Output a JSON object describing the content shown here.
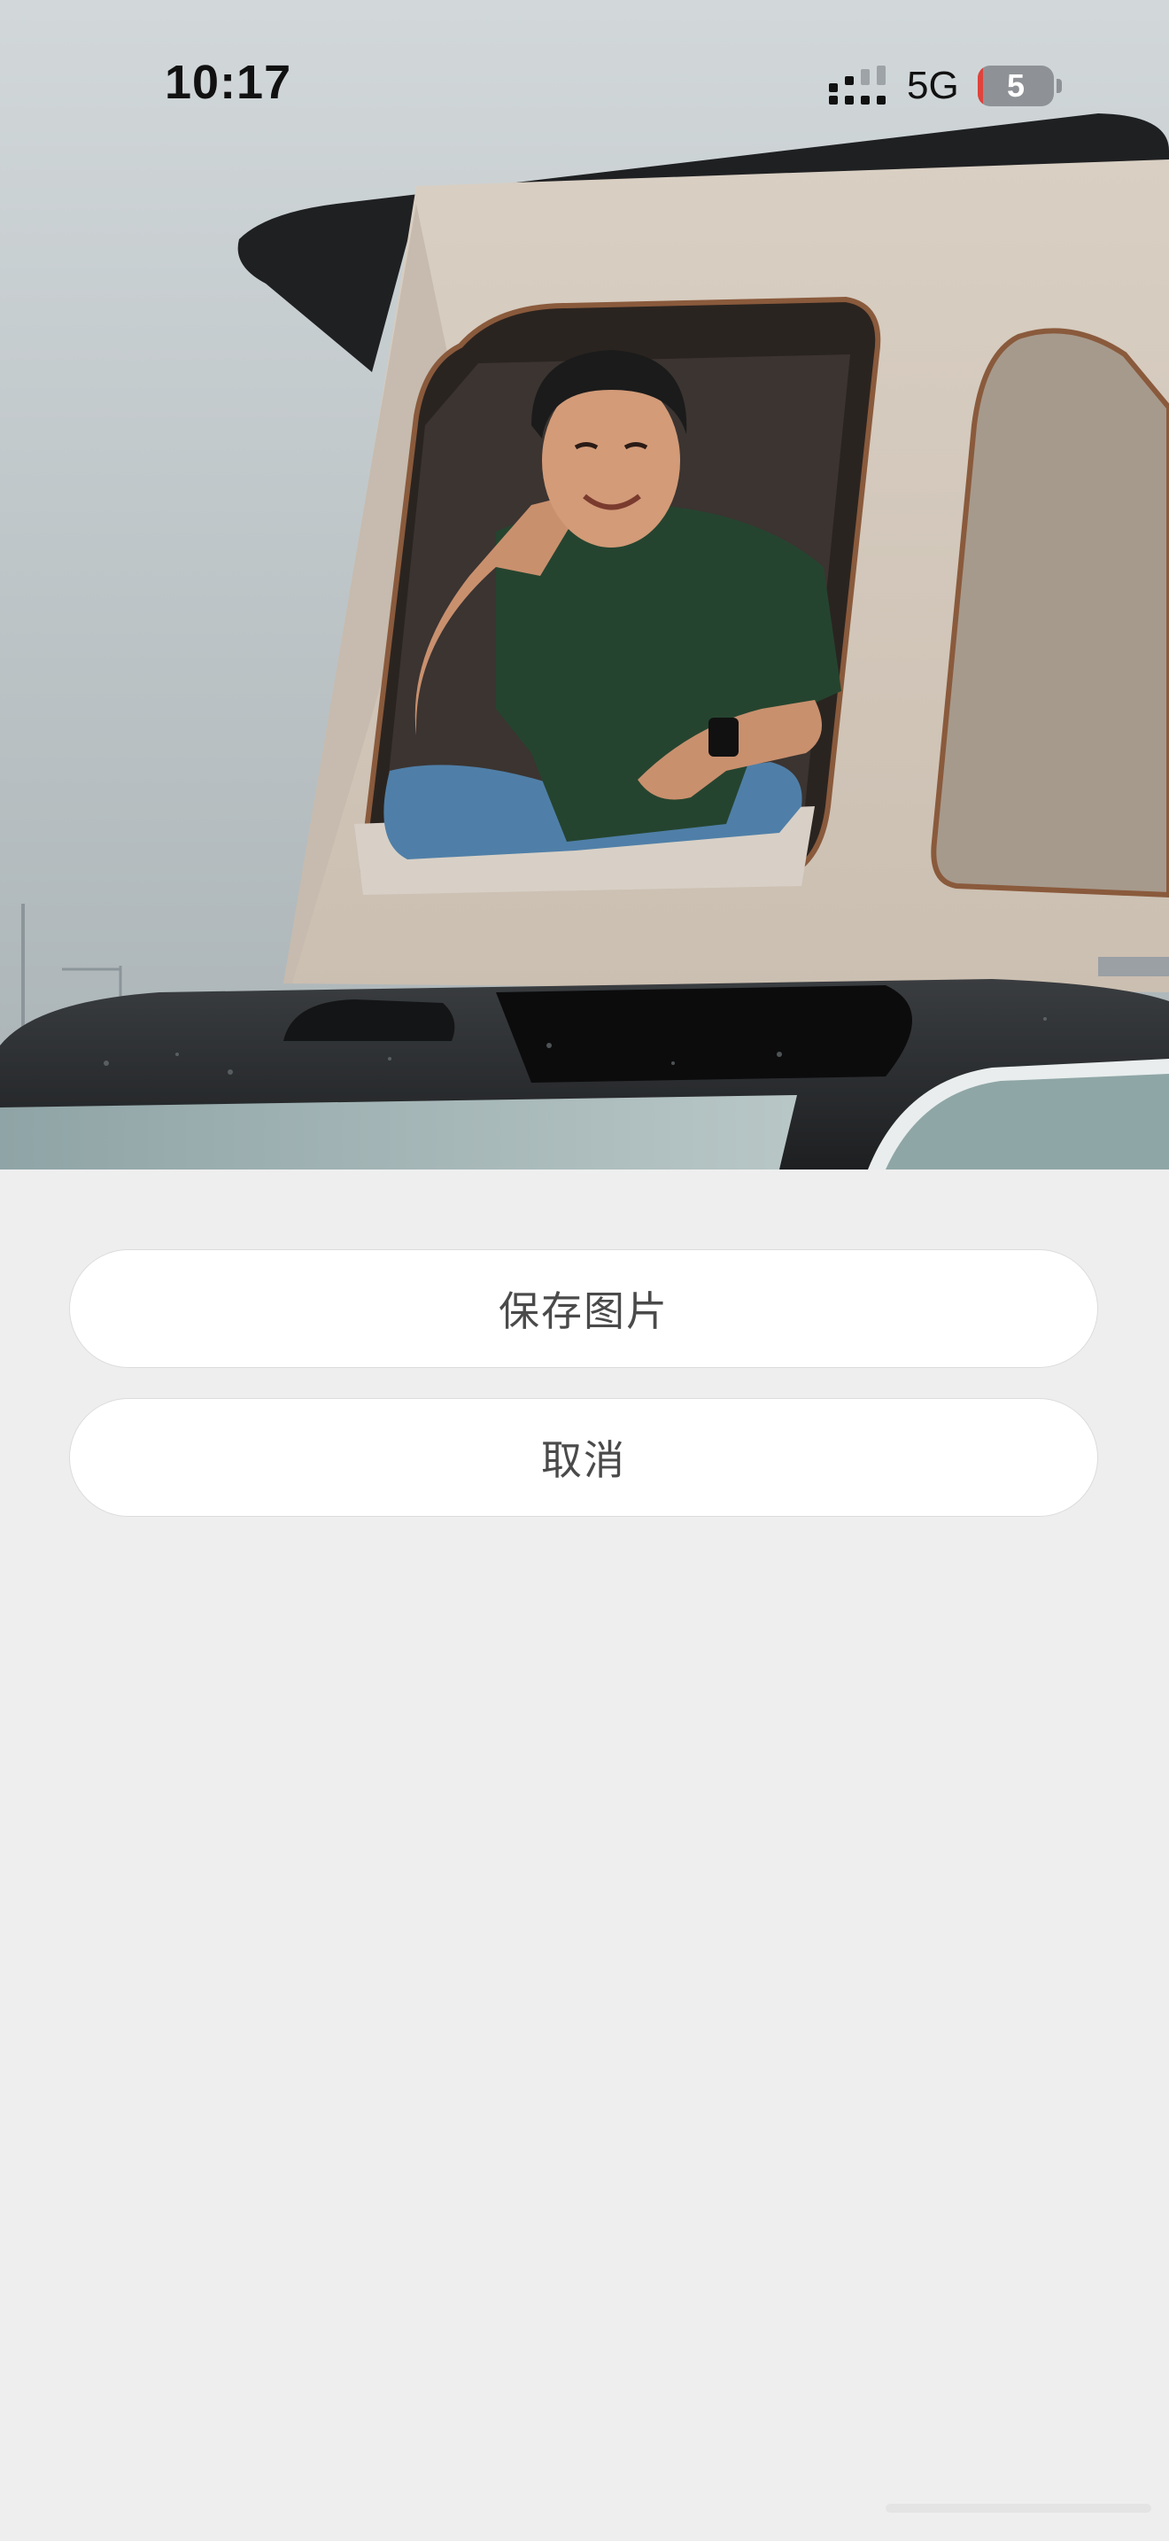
{
  "status_bar": {
    "time": "10:17",
    "network": "5G",
    "battery_text": "5",
    "battery_level_fraction": 0.05,
    "signal_icon": "signal-bars-icon",
    "battery_icon": "battery-icon"
  },
  "photo": {
    "description_icon": "photo-image"
  },
  "sheet": {
    "save_label": "保存图片",
    "cancel_label": "取消"
  },
  "colors": {
    "sheet_background": "#eeeeee",
    "button_background": "#ffffff",
    "button_text": "#4a4a4a",
    "battery_low": "#e0423c"
  }
}
